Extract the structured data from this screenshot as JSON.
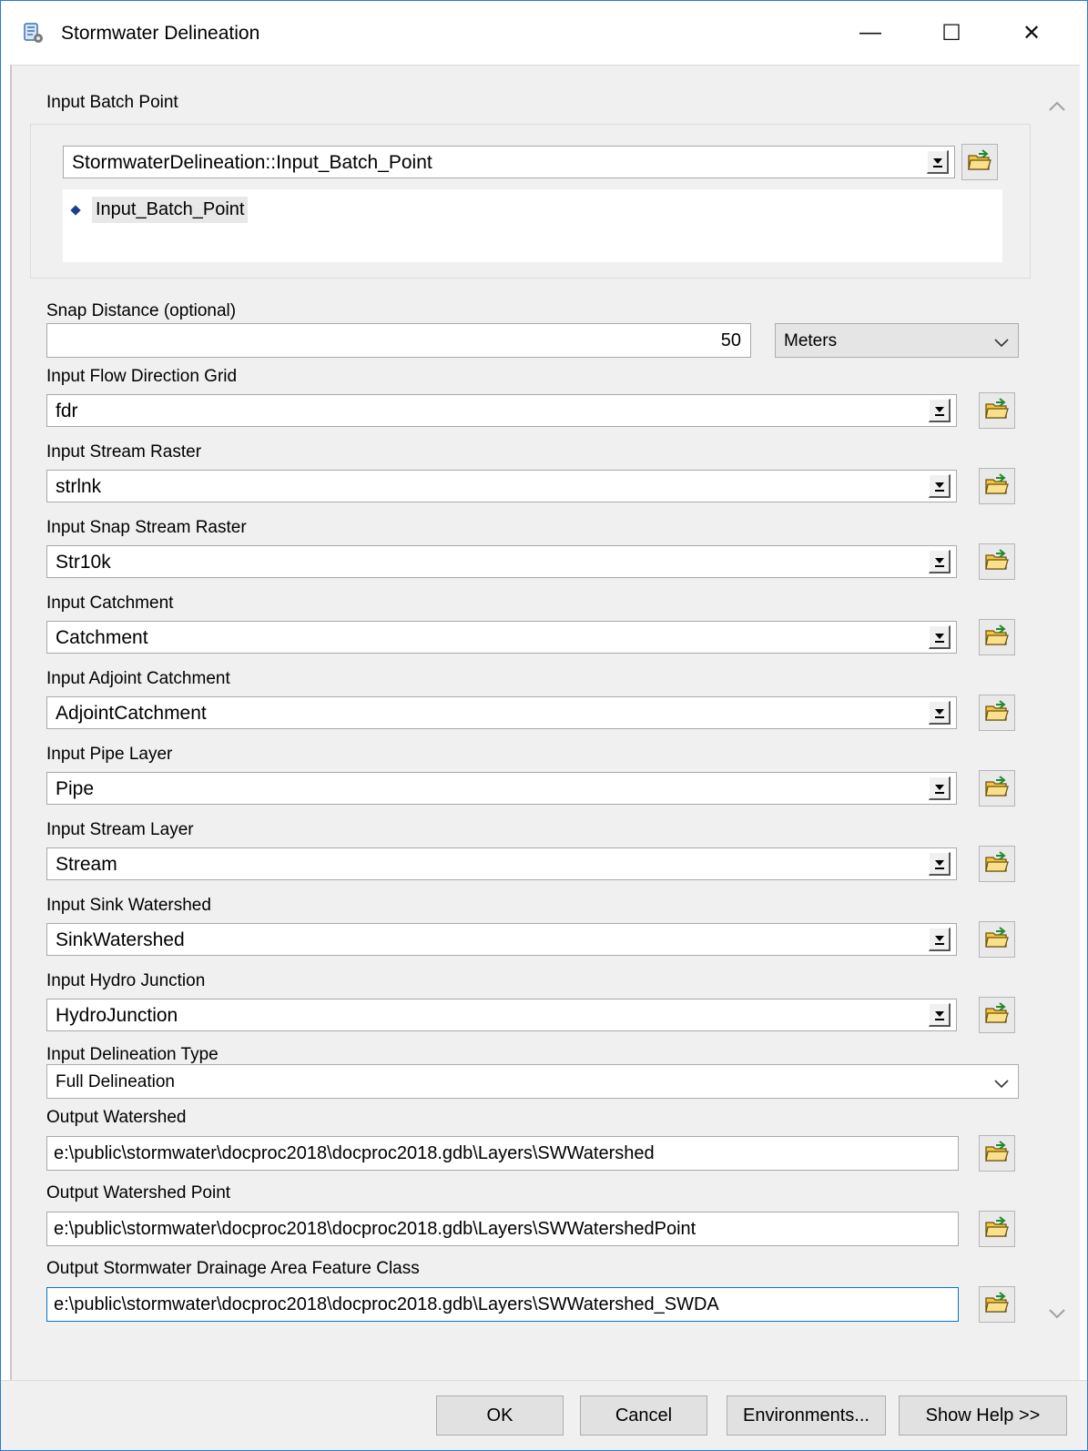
{
  "window": {
    "title": "Stormwater Delineation",
    "icon": "toolbox-script-icon",
    "controls": {
      "minimize": "—",
      "maximize": "☐",
      "close": "✕"
    }
  },
  "batch_point": {
    "label": "Input Batch Point",
    "value": "StormwaterDelineation::Input_Batch_Point",
    "list_items": [
      "Input_Batch_Point"
    ]
  },
  "snap": {
    "label": "Snap Distance (optional)",
    "value": "50",
    "units": "Meters"
  },
  "params": [
    {
      "label": "Input Flow Direction Grid",
      "value": "fdr"
    },
    {
      "label": "Input Stream Raster",
      "value": "strlnk"
    },
    {
      "label": "Input Snap Stream Raster",
      "value": "Str10k"
    },
    {
      "label": "Input Catchment",
      "value": "Catchment"
    },
    {
      "label": "Input Adjoint Catchment",
      "value": "AdjointCatchment"
    },
    {
      "label": "Input Pipe Layer",
      "value": "Pipe"
    },
    {
      "label": "Input Stream Layer",
      "value": "Stream"
    },
    {
      "label": "Input Sink Watershed",
      "value": "SinkWatershed"
    },
    {
      "label": "Input Hydro Junction",
      "value": "HydroJunction"
    }
  ],
  "delineation_type": {
    "label": "Input Delineation Type",
    "value": "Full Delineation"
  },
  "outputs": [
    {
      "label": "Output Watershed",
      "value": "e:\\public\\stormwater\\docproc2018\\docproc2018.gdb\\Layers\\SWWatershed"
    },
    {
      "label": "Output Watershed Point",
      "value": "e:\\public\\stormwater\\docproc2018\\docproc2018.gdb\\Layers\\SWWatershedPoint"
    },
    {
      "label": "Output Stormwater Drainage Area Feature Class",
      "value": "e:\\public\\stormwater\\docproc2018\\docproc2018.gdb\\Layers\\SWWatershed_SWDA"
    }
  ],
  "buttons": {
    "ok": "OK",
    "cancel": "Cancel",
    "environments": "Environments...",
    "help": "Show Help >>"
  },
  "colors": {
    "accent": "#0078d7",
    "window_border": "#2b79d6",
    "dialog_bg": "#f0f0f0",
    "folder_yellow": "#f5c542"
  }
}
